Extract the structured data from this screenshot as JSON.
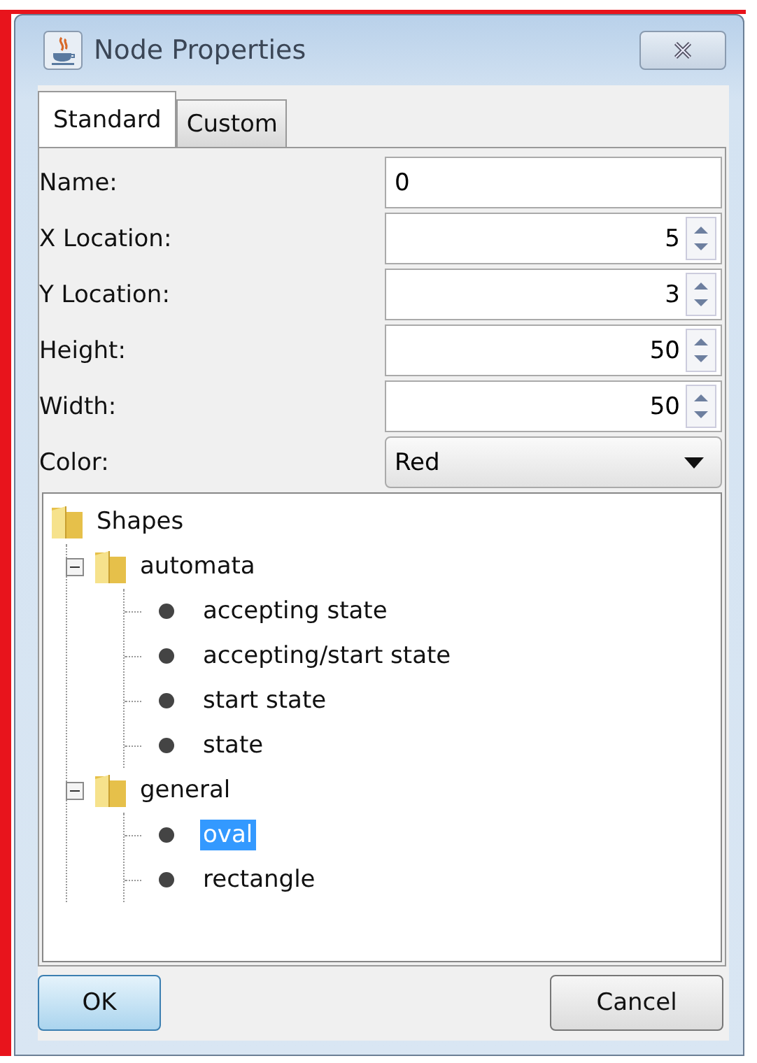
{
  "window": {
    "title": "Node Properties"
  },
  "tabs": [
    {
      "label": "Standard",
      "selected": true
    },
    {
      "label": "Custom",
      "selected": false
    }
  ],
  "fields": [
    {
      "kind": "text",
      "label": "Name:",
      "value": "0"
    },
    {
      "kind": "spinner",
      "label": "X Location:",
      "value": "5"
    },
    {
      "kind": "spinner",
      "label": "Y Location:",
      "value": "3"
    },
    {
      "kind": "spinner",
      "label": "Height:",
      "value": "50"
    },
    {
      "kind": "spinner",
      "label": "Width:",
      "value": "50"
    },
    {
      "kind": "dropdown",
      "label": "Color:",
      "value": "Red"
    }
  ],
  "tree": [
    {
      "label": "Shapes",
      "kind": "folder",
      "selected": false,
      "children": [
        {
          "label": "automata",
          "kind": "folder",
          "expanded": true,
          "selected": false,
          "children": [
            {
              "label": "accepting state",
              "kind": "leaf",
              "selected": false
            },
            {
              "label": "accepting/start state",
              "kind": "leaf",
              "selected": false
            },
            {
              "label": "start state",
              "kind": "leaf",
              "selected": false
            },
            {
              "label": "state",
              "kind": "leaf",
              "selected": false
            }
          ]
        },
        {
          "label": "general",
          "kind": "folder",
          "expanded": true,
          "selected": false,
          "children": [
            {
              "label": "oval",
              "kind": "leaf",
              "selected": true
            },
            {
              "label": "rectangle",
              "kind": "leaf",
              "selected": false
            }
          ]
        }
      ]
    }
  ],
  "buttons": [
    {
      "label": "OK",
      "kind": "default"
    },
    {
      "label": "Cancel",
      "kind": "normal"
    }
  ]
}
